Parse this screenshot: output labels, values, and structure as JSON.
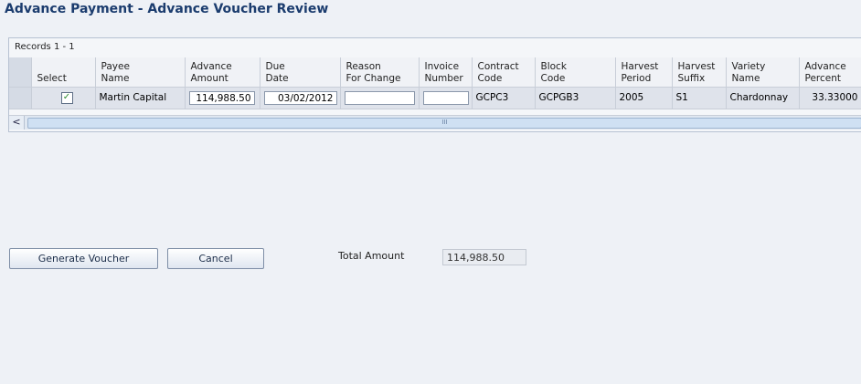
{
  "page": {
    "title": "Advance Payment - Advance Voucher Review"
  },
  "grid": {
    "records_label": "Records 1 - 1",
    "headers": [
      {
        "l1": "Select",
        "l2": ""
      },
      {
        "l1": "Payee",
        "l2": "Name"
      },
      {
        "l1": "Advance",
        "l2": "Amount"
      },
      {
        "l1": "Due",
        "l2": "Date"
      },
      {
        "l1": "Reason",
        "l2": "For Change"
      },
      {
        "l1": "Invoice",
        "l2": "Number"
      },
      {
        "l1": "Contract",
        "l2": "Code"
      },
      {
        "l1": "Block",
        "l2": "Code"
      },
      {
        "l1": "Harvest",
        "l2": "Period"
      },
      {
        "l1": "Harvest",
        "l2": "Suffix"
      },
      {
        "l1": "Variety",
        "l2": "Name"
      },
      {
        "l1": "Advance",
        "l2": "Percent"
      }
    ],
    "rows": [
      {
        "selected": "✓",
        "payee_name": "Martin Capital",
        "advance_amount": "114,988.50",
        "due_date": "03/02/2012",
        "reason_for_change": "",
        "invoice_number": "",
        "contract_code": "GCPC3",
        "block_code": "GCPGB3",
        "harvest_period": "2005",
        "harvest_suffix": "S1",
        "variety_name": "Chardonnay",
        "advance_percent": "33.33000"
      }
    ],
    "scroll_left_glyph": "<",
    "scroll_thumb_glyph": "III"
  },
  "actions": {
    "generate_voucher": "Generate Voucher",
    "cancel": "Cancel"
  },
  "total": {
    "label": "Total Amount",
    "value": "114,988.50"
  }
}
